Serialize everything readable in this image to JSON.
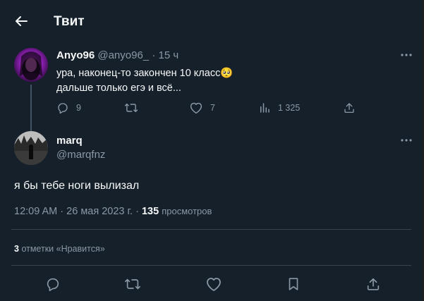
{
  "header": {
    "title": "Твит"
  },
  "parent_tweet": {
    "author_name": "Anyo96",
    "handle": "@anyo96_",
    "sep": "·",
    "time": "15 ч",
    "text_line1": "ура, наконец-то закончен 10 класс",
    "emoji": "🥺",
    "text_line2": "дальше только егэ и всё...",
    "replies": "9",
    "likes": "7",
    "views": "1 325"
  },
  "main_tweet": {
    "author_name": "marq",
    "handle": "@marqfnz",
    "text": "я бы тебе ноги вылизал",
    "time": "12:09 AM",
    "date_sep": "·",
    "date": "26 мая 2023 г.",
    "view_sep": "·",
    "views_count": "135",
    "views_label": "просмотров"
  },
  "likes_row": {
    "count": "3",
    "label": "отметки «Нравится»"
  },
  "colors": {
    "background": "#15202b",
    "text": "#f7f9f9",
    "muted": "#8b98a5",
    "divider": "#38444d"
  }
}
